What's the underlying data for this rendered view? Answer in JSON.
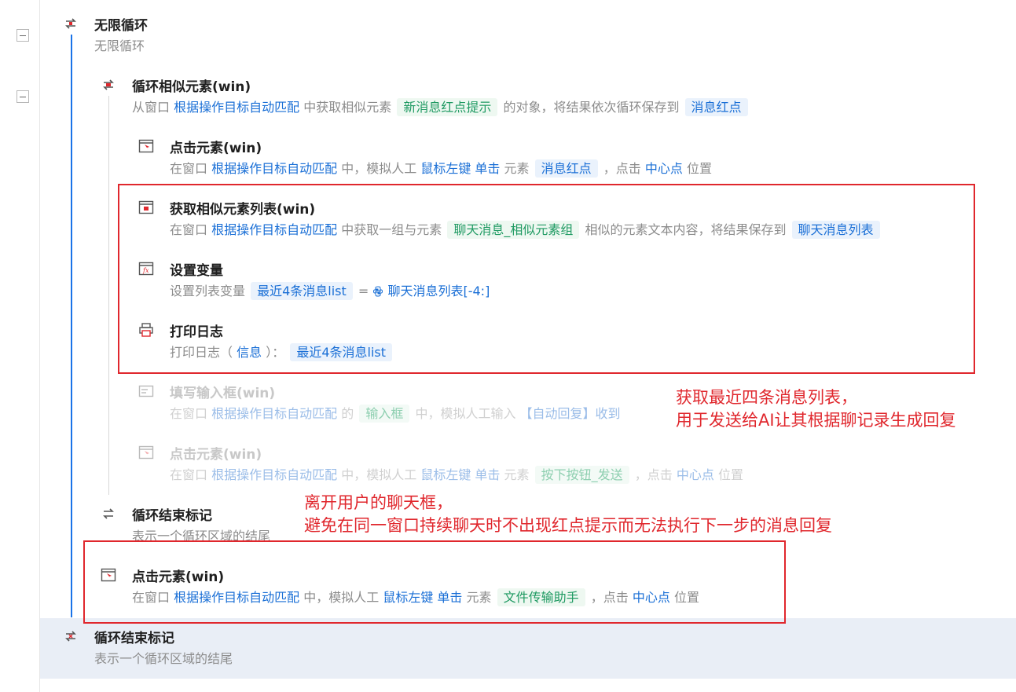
{
  "colors": {
    "accent": "#1a6fd6",
    "green_tag": "#1f9a62",
    "annotation": "#e0272d",
    "selected_row": "#e9eef6"
  },
  "steps": {
    "loop_infinite": {
      "title": "无限循环",
      "desc": "无限循环"
    },
    "loop_similar": {
      "title": "循环相似元素(win)",
      "d1": "从窗口",
      "link1": "根据操作目标自动匹配",
      "d2": "中获取相似元素",
      "tag1": "新消息红点提示",
      "d3": "的对象，将结果依次循环保存到",
      "tag2": "消息红点"
    },
    "click1": {
      "title": "点击元素(win)",
      "d1": "在窗口",
      "link1": "根据操作目标自动匹配",
      "d2": "中，模拟人工",
      "link2": "鼠标左键 单击",
      "d3": "元素",
      "tag1": "消息红点",
      "d4": "，点击",
      "link3": "中心点",
      "d5": "位置"
    },
    "get_list": {
      "title": "获取相似元素列表(win)",
      "d1": "在窗口",
      "link1": "根据操作目标自动匹配",
      "d2": "中获取一组与元素",
      "tag1": "聊天消息_相似元素组",
      "d3": "相似的元素文本内容，将结果保存到",
      "tag2": "聊天消息列表"
    },
    "set_var": {
      "title": "设置变量",
      "d1": "设置列表变量",
      "tag1": "最近4条消息list",
      "d2": "=",
      "link1": "聊天消息列表[-4:]"
    },
    "print_log": {
      "title": "打印日志",
      "d1": "打印日志（",
      "link1": "信息",
      "d2": "）：",
      "tag1": "最近4条消息list"
    },
    "fill_input": {
      "title": "填写输入框(win)",
      "d1": "在窗口",
      "link1": "根据操作目标自动匹配",
      "d2": "的",
      "tag1": "输入框",
      "d3": "中，模拟人工输入",
      "link2": "【自动回复】收到"
    },
    "click2": {
      "title": "点击元素(win)",
      "d1": "在窗口",
      "link1": "根据操作目标自动匹配",
      "d2": "中，模拟人工",
      "link2": "鼠标左键 单击",
      "d3": "元素",
      "tag1": "按下按钮_发送",
      "d4": "，点击",
      "link3": "中心点",
      "d5": "位置"
    },
    "loop_end_inner": {
      "title": "循环结束标记",
      "desc": "表示一个循环区域的结尾"
    },
    "click3": {
      "title": "点击元素(win)",
      "d1": "在窗口",
      "link1": "根据操作目标自动匹配",
      "d2": "中，模拟人工",
      "link2": "鼠标左键 单击",
      "d3": "元素",
      "tag1": "文件传输助手",
      "d4": "，点击",
      "link3": "中心点",
      "d5": "位置"
    },
    "loop_end_outer": {
      "title": "循环结束标记",
      "desc": "表示一个循环区域的结尾"
    }
  },
  "annotations": {
    "note1_line1": "获取最近四条消息列表，",
    "note1_line2": "用于发送给AI让其根据聊记录生成回复",
    "note2_line1": "离开用户的聊天框，",
    "note2_line2": "避免在同一窗口持续聊天时不出现红点提示而无法执行下一步的消息回复"
  },
  "icons": [
    "loop-icon",
    "loop-similar-icon",
    "click-element-icon",
    "list-icon",
    "variable-icon",
    "print-icon",
    "input-icon",
    "loop-end-icon",
    "python-icon"
  ]
}
